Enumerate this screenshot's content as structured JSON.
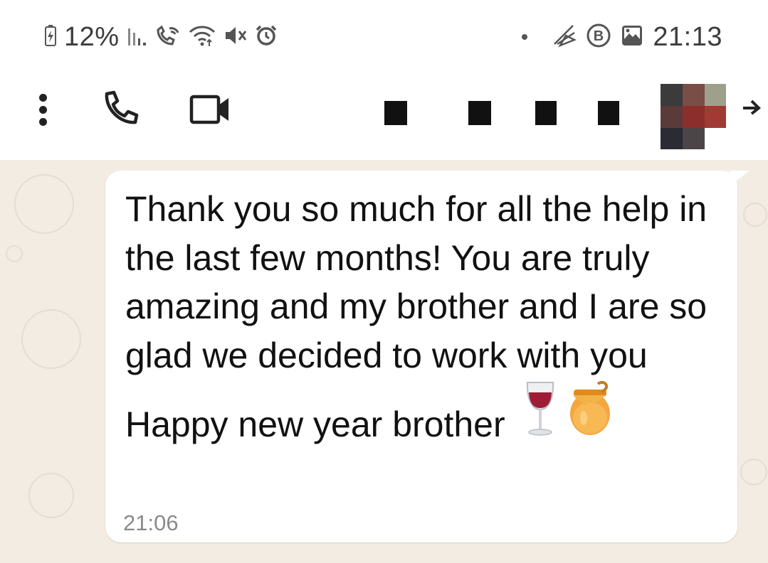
{
  "status_bar": {
    "battery_percent": "12%",
    "time": "21:13",
    "left_icons": [
      "battery-charging-icon",
      "signal-icon",
      "wifi-call-icon",
      "wifi-icon",
      "mute-icon",
      "alarm-icon"
    ],
    "right_icons": [
      "notification-dot-icon",
      "app-notification-icon",
      "b-badge-icon",
      "gallery-icon"
    ]
  },
  "header": {
    "icons": [
      "more-options-icon",
      "voice-call-icon",
      "video-call-icon",
      "back-arrow-icon"
    ],
    "contact_name_redacted": true,
    "colors": {
      "redaction": "#111111"
    }
  },
  "message": {
    "text": "Thank you so much for all the help in the last few months! You are truly amazing and my brother and I are so glad we decided to work with you Happy new year brother",
    "emojis": [
      "wine-glass-emoji",
      "honey-pot-emoji"
    ],
    "time": "21:06"
  },
  "colors": {
    "chat_background": "#f3ece3",
    "bubble": "#ffffff",
    "timestamp": "#8a8a8a"
  }
}
